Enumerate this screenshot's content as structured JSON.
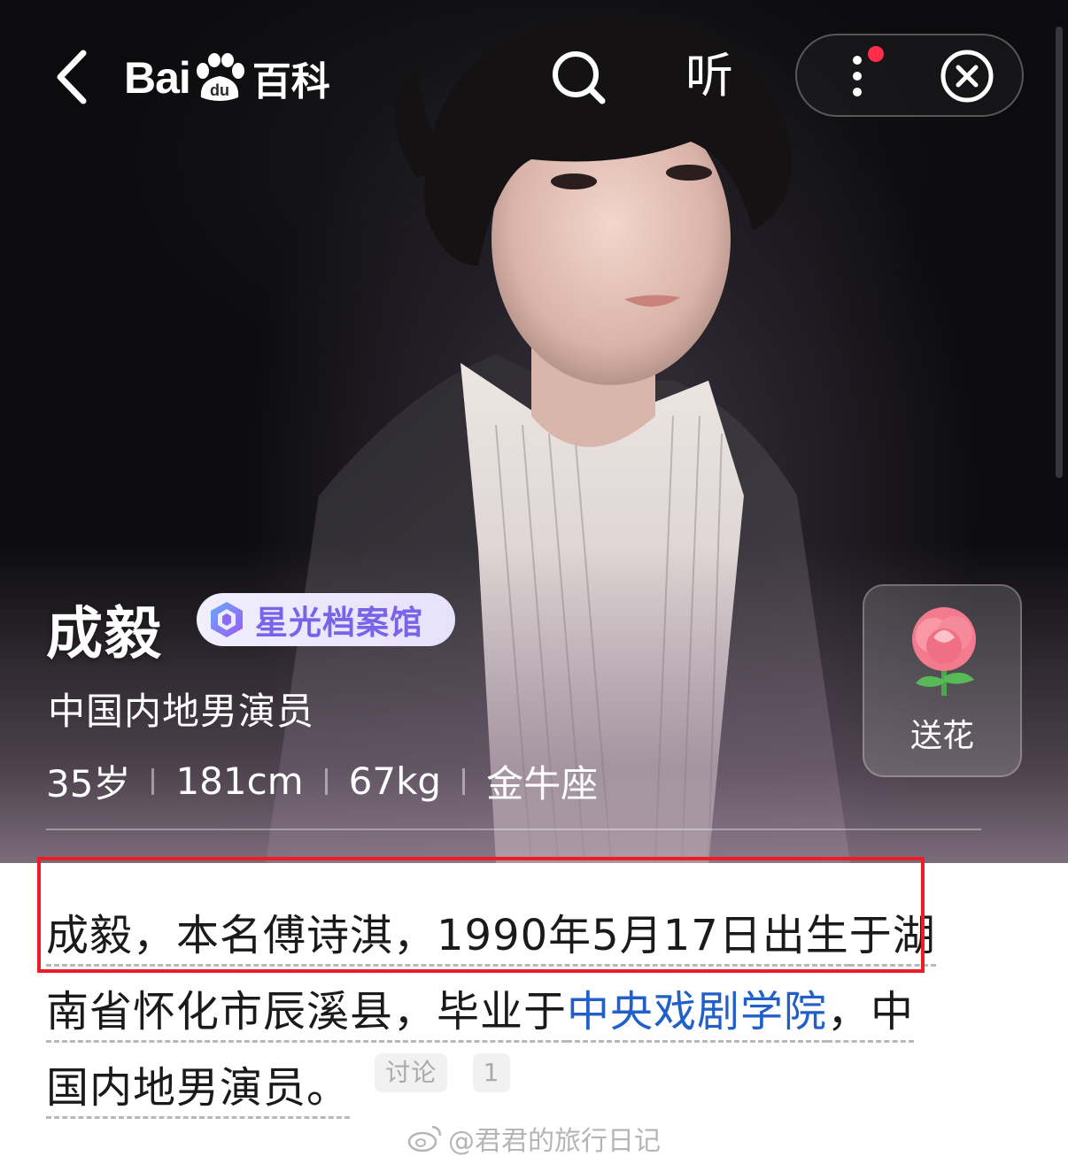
{
  "nav": {
    "logo_text_bai": "Bai",
    "logo_text_du": "du",
    "logo_text_baike": "百科",
    "listen_label": "听"
  },
  "profile": {
    "name": "成毅",
    "badge_label": "星光档案馆",
    "occupation": "中国内地男演员",
    "stats": [
      "35岁",
      "181cm",
      "67kg",
      "金牛座"
    ],
    "flower_label": "送花"
  },
  "intro": {
    "line1_part1": "成毅，本名傅诗淇，1990年5月17日出生",
    "line1_part2": "于湖",
    "line2_part1": "南省怀化市辰溪县，毕业于",
    "line2_link": "中央戏剧学院",
    "line2_part2": "，中",
    "line3": "国内地男演员。",
    "tag_discuss": "讨论",
    "tag_count": "1"
  },
  "watermark": "@君君的旅行日记",
  "colors": {
    "accent_badge": "#7a63e8",
    "link": "#2060c8",
    "highlight": "#ee1c24",
    "notification_dot": "#ff2d4a"
  },
  "icons": [
    "back-arrow-icon",
    "baidu-paw-icon",
    "search-icon",
    "more-icon",
    "close-circle-icon",
    "starlight-badge-icon",
    "rose-icon",
    "weibo-icon"
  ]
}
